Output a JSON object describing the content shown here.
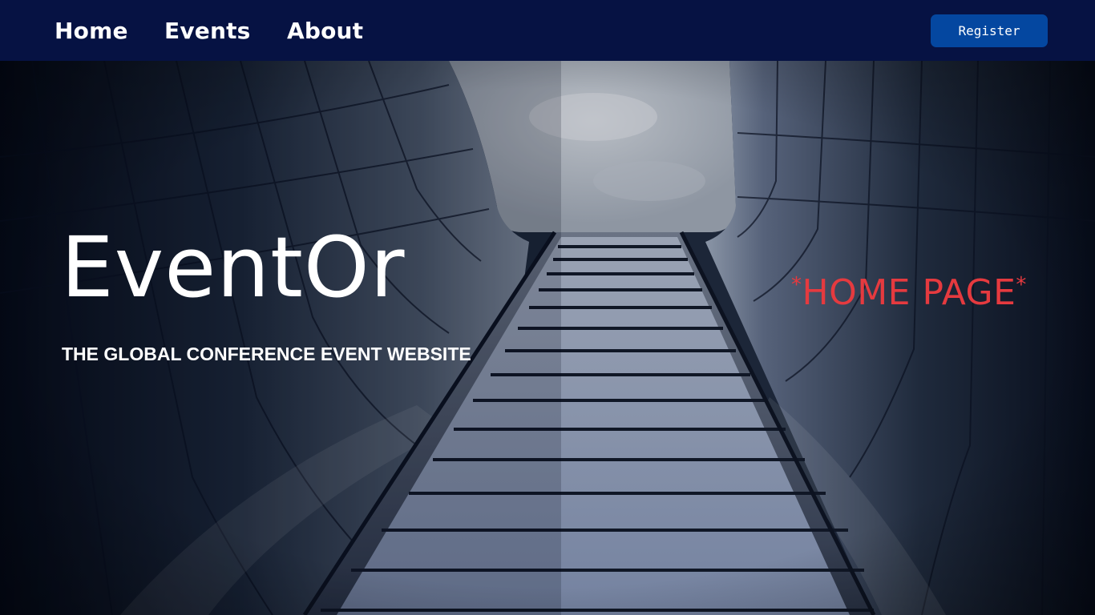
{
  "nav": {
    "links": [
      "Home",
      "Events",
      "About"
    ],
    "register_label": "Register"
  },
  "hero": {
    "title": "EventOr",
    "tagline": "THE GLOBAL CONFERENCE EVENT WEBSITE",
    "page_tag": {
      "star_left": "*",
      "text": "HOME PAGE",
      "star_right": "*"
    },
    "background_image": "building-looking-up-photo"
  },
  "colors": {
    "navbar_bg": "#061243",
    "register_button_bg": "#0447a0",
    "page_tag_color": "#e53a3f",
    "text_primary": "#ffffff"
  }
}
